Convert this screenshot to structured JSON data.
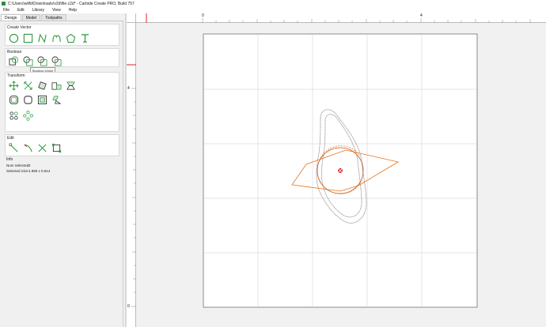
{
  "window": {
    "title": "C:\\Users\\wilfd\\Downloads\\v2d\\file.c2d* - Carbide Create PRO, Build 757"
  },
  "menu": {
    "items": [
      "File",
      "Edit",
      "Library",
      "View",
      "Help"
    ]
  },
  "tabs": [
    {
      "label": "Design",
      "active": true
    },
    {
      "label": "Model",
      "active": false
    },
    {
      "label": "Toolpaths",
      "active": false
    }
  ],
  "sections": {
    "create_vector": "Create Vector",
    "boolean": "Boolean",
    "transform": "Transform",
    "edit": "Edit",
    "info": "Info"
  },
  "tooltip": {
    "text": "Boolean Union"
  },
  "info": {
    "num_selected_label": "Num Selected:",
    "num_selected_value": "2",
    "selected_size_label": "Selected Size:",
    "selected_size_value": "1.980 x 0.814"
  },
  "ruler": {
    "top_labels": [
      "0",
      "4"
    ],
    "left_labels": [
      "4",
      "0"
    ]
  },
  "icons": {
    "create_vector": [
      "circle-tool-icon",
      "rectangle-tool-icon",
      "polyline-tool-icon",
      "curve-tool-icon",
      "polygon-tool-icon",
      "text-tool-icon"
    ],
    "boolean": [
      "boolean-union-icon",
      "boolean-subtract-icon",
      "boolean-intersect-icon",
      "boolean-weld-icon"
    ],
    "transform": [
      "move-icon",
      "scale-icon",
      "rotate-icon",
      "align-icon",
      "mirror-icon",
      "offset-icon",
      "fillet-icon",
      "group-icon",
      "join-icon",
      "array-icon",
      "circle-array-icon"
    ],
    "edit": [
      "node-edit-icon",
      "trim-icon",
      "cut-icon",
      "bounding-box-icon"
    ]
  },
  "colors": {
    "accent": "#2f9b3e",
    "selection": "#e8731d",
    "marker": "#e02020",
    "grid": "#cccccc"
  }
}
